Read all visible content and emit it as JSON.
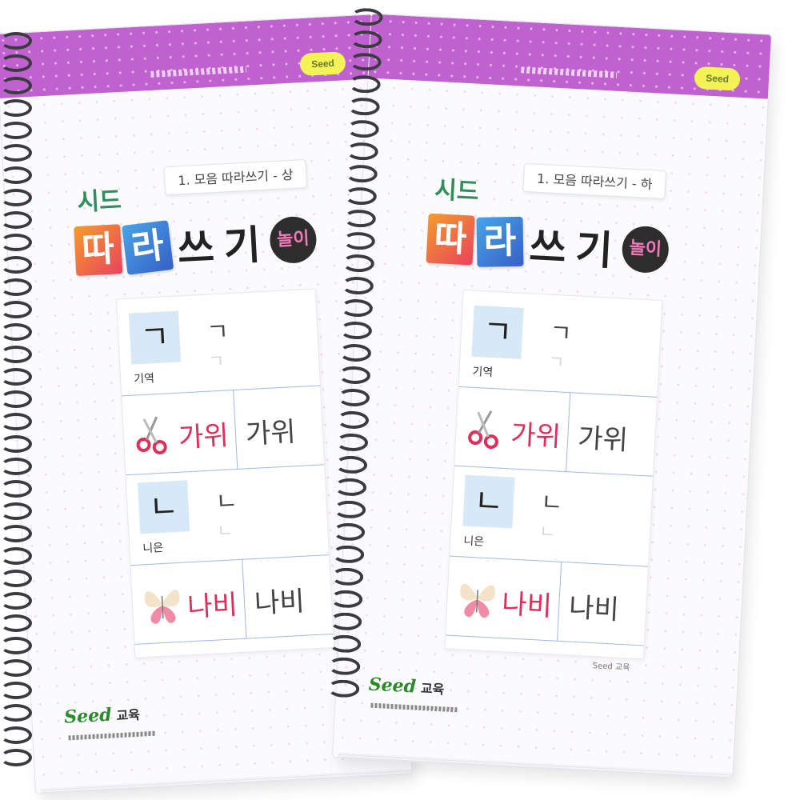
{
  "books": [
    {
      "id": "back",
      "badge": "Seed",
      "brand": "시드",
      "subtitle": "1. 모음 따라쓰기 - 상",
      "title_tile_1": "따",
      "title_tile_2": "라",
      "title_glyph_1": "쓰",
      "title_glyph_2": "기",
      "title_circle": "놀이",
      "rows": [
        {
          "letter": "ㄱ",
          "name": "기역",
          "guide": "ㄱ"
        },
        {
          "word": "가위",
          "trace": "가위",
          "picture": "scissors-icon"
        },
        {
          "letter": "ㄴ",
          "name": "니은",
          "guide": "ㄴ"
        },
        {
          "word": "나비",
          "trace": "나비",
          "picture": "butterfly-icon"
        }
      ],
      "publisher": "Seed",
      "publisher_suffix": "교육"
    },
    {
      "id": "front",
      "badge": "Seed",
      "brand": "시드",
      "subtitle": "1. 모음 따라쓰기 - 하",
      "title_tile_1": "따",
      "title_tile_2": "라",
      "title_glyph_1": "쓰",
      "title_glyph_2": "기",
      "title_circle": "놀이",
      "rows": [
        {
          "letter": "ㄱ",
          "name": "기역",
          "guide": "ㄱ"
        },
        {
          "word": "가위",
          "trace": "가위",
          "picture": "scissors-icon"
        },
        {
          "letter": "ㄴ",
          "name": "니은",
          "guide": "ㄴ"
        },
        {
          "word": "나비",
          "trace": "나비",
          "picture": "butterfly-icon"
        }
      ],
      "footnote": "Seed 교육",
      "publisher": "Seed",
      "publisher_suffix": "교육"
    }
  ],
  "colors": {
    "band": "#bf62cf",
    "badge": "#f3f257",
    "brand_green": "#2f8f5a",
    "accent_red": "#e02e5a",
    "letter_box": "#d7e8f7",
    "rule_blue": "#9db8e8",
    "spiral": "#3a3a40"
  }
}
